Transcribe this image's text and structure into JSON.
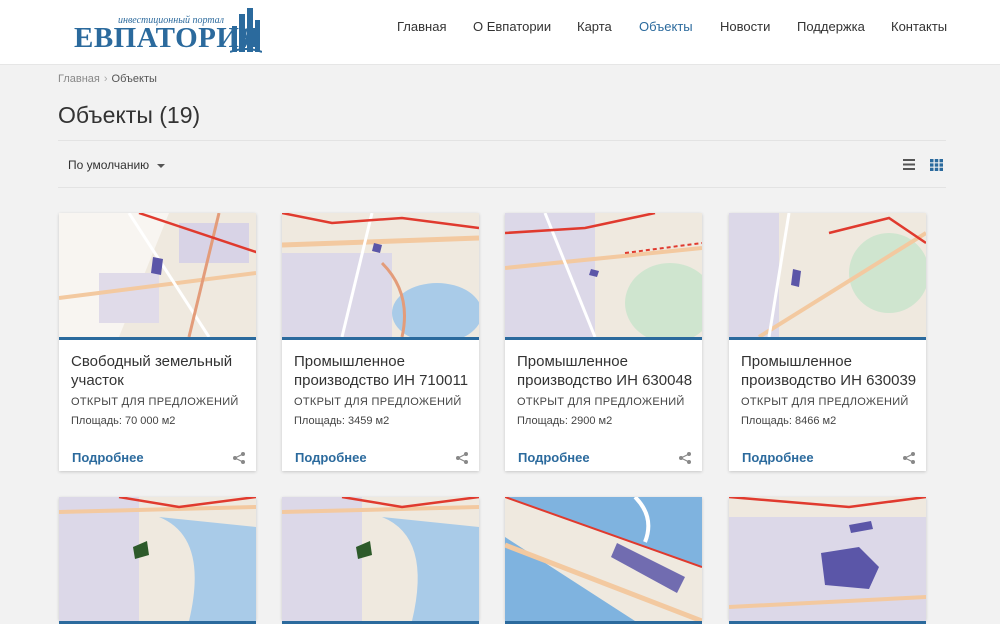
{
  "logo": {
    "tagline": "инвестиционный портал",
    "word": "ЕВПАТОРИЯ"
  },
  "nav": [
    {
      "label": "Главная",
      "active": false
    },
    {
      "label": "О Евпатории",
      "active": false
    },
    {
      "label": "Карта",
      "active": false
    },
    {
      "label": "Объекты",
      "active": true
    },
    {
      "label": "Новости",
      "active": false
    },
    {
      "label": "Поддержка",
      "active": false
    },
    {
      "label": "Контакты",
      "active": false
    }
  ],
  "breadcrumb": {
    "home": "Главная",
    "sep": "›",
    "current": "Объекты"
  },
  "page_title": "Объекты (19)",
  "sort": {
    "selected": "По умолчанию"
  },
  "colors": {
    "brand": "#2b6a9d",
    "accent_parcel": "#5b56a8",
    "border_red": "#e03a2e"
  },
  "cards": [
    {
      "title": "Свободный земельный участок",
      "status": "Открыт для предложений",
      "area": "Площадь: 70 000 м2",
      "more": "Подробнее"
    },
    {
      "title": "Промышленное производство ИН 710011",
      "status": "Открыт для предложений",
      "area": "Площадь: 3459 м2",
      "more": "Подробнее"
    },
    {
      "title": "Промышленное производство ИН 630048",
      "status": "Открыт для предложений",
      "area": "Площадь: 2900 м2",
      "more": "Подробнее"
    },
    {
      "title": "Промышленное производство ИН 630039",
      "status": "Открыт для предложений",
      "area": "Площадь: 8466 м2",
      "more": "Подробнее"
    }
  ]
}
